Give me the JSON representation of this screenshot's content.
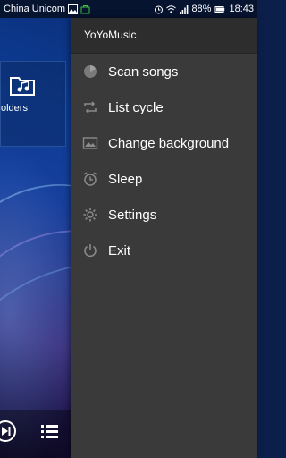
{
  "status_bar": {
    "carrier": "China Unicom",
    "battery": "88%",
    "time": "18:43",
    "icons": [
      "image-notification-icon",
      "bag-icon",
      "alarm-icon",
      "wifi-icon",
      "signal-icon",
      "battery-icon"
    ]
  },
  "background": {
    "folders_label": "olders",
    "bottom_buttons": [
      "next-icon",
      "playlist-icon"
    ]
  },
  "drawer": {
    "title": "YoYoMusic",
    "items": [
      {
        "label": "Scan songs",
        "icon": "scan-icon"
      },
      {
        "label": "List cycle",
        "icon": "repeat-icon"
      },
      {
        "label": "Change background",
        "icon": "image-icon"
      },
      {
        "label": "Sleep",
        "icon": "alarm-clock-icon"
      },
      {
        "label": "Settings",
        "icon": "gear-icon"
      },
      {
        "label": "Exit",
        "icon": "power-icon"
      }
    ]
  },
  "colors": {
    "drawer_bg": "#3a3a3a",
    "drawer_header_bg": "#2d2d2d",
    "text": "#ffffff",
    "icon": "#8a8a8a",
    "accent": "#2f7cd8"
  }
}
